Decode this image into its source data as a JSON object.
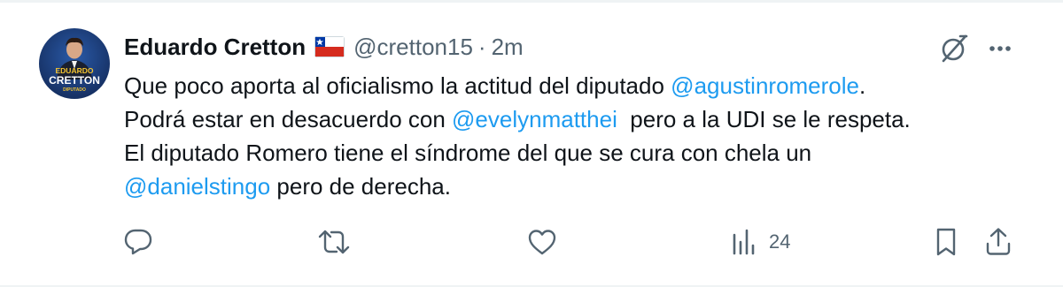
{
  "author": {
    "display_name": "Eduardo Cretton",
    "handle": "@cretton15",
    "separator": "·",
    "time": "2m",
    "flag_icon": "chile-flag-icon",
    "avatar": {
      "line1": "EDUARDO",
      "line2": "CRETTON",
      "line3": "DIPUTADO"
    }
  },
  "tweet": {
    "lines": [
      [
        {
          "text": "Que poco aporta al oficialismo la actitud del diputado ",
          "mention": false
        },
        {
          "text": "@agustinromerole",
          "mention": true
        },
        {
          "text": ".",
          "mention": false
        }
      ],
      [
        {
          "text": "Podrá estar en desacuerdo con ",
          "mention": false
        },
        {
          "text": "@evelynmatthei",
          "mention": true
        },
        {
          "text": "  pero a la UDI se le respeta.",
          "mention": false
        }
      ],
      [
        {
          "text": "El diputado Romero tiene el síndrome del que se cura con chela un",
          "mention": false
        }
      ],
      [
        {
          "text": "@danielstingo",
          "mention": true
        },
        {
          "text": " pero de derecha.",
          "mention": false
        }
      ]
    ]
  },
  "actions": {
    "reply_icon": "reply-icon",
    "retweet_icon": "retweet-icon",
    "like_icon": "like-icon",
    "views_icon": "views-icon",
    "views_count": "24",
    "bookmark_icon": "bookmark-icon",
    "share_icon": "share-icon"
  },
  "colors": {
    "text": "#0f1419",
    "muted": "#536471",
    "link": "#1d9bf0",
    "avatar_bg": "#1c3a6e"
  }
}
